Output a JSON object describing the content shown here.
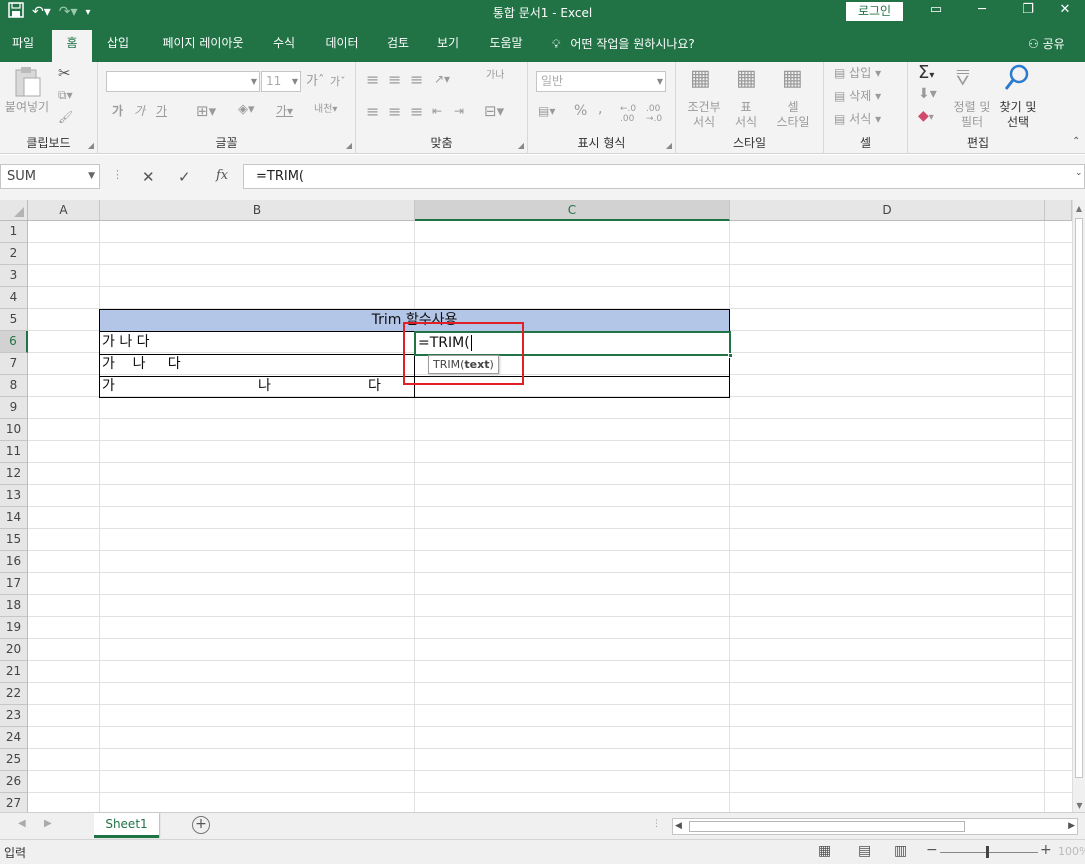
{
  "window": {
    "title": "통합 문서1  -  Excel",
    "login_label": "로그인"
  },
  "tabs": [
    "파일",
    "홈",
    "삽입",
    "페이지 레이아웃",
    "수식",
    "데이터",
    "검토",
    "보기",
    "도움말"
  ],
  "active_tab": "홈",
  "tell_me": "어떤 작업을 원하시나요?",
  "share_label": "공유",
  "ribbon": {
    "groups": {
      "clipboard": "클립보드",
      "font": "글꼴",
      "alignment": "맞춤",
      "number": "표시 형식",
      "styles": "스타일",
      "cells": "셀",
      "editing": "편집"
    },
    "paste_label": "붙여넣기",
    "font_size": "11",
    "font_bold": "가",
    "font_italic": "가",
    "font_underline": "가",
    "font_grow": "가",
    "font_shrink": "가",
    "font_color_glyph": "가",
    "phonetic_glyph": "내천",
    "vertical_text_glyph": "가나",
    "number_format": "일반",
    "percent": "%",
    "comma": ",",
    "conditional_format": "조건부\n서식",
    "format_as_table": "표\n서식",
    "cell_styles": "셀\n스타일",
    "insert": "삽입",
    "delete": "삭제",
    "format": "서식",
    "sort_filter": "정렬 및\n필터",
    "find_select": "찾기 및\n선택"
  },
  "formula_bar": {
    "name_box": "SUM",
    "cancel": "✕",
    "enter": "✓",
    "fx": "fx",
    "content": "=TRIM("
  },
  "grid": {
    "columns": [
      "A",
      "B",
      "C",
      "D"
    ],
    "selected_column": "C",
    "rows": [
      "1",
      "2",
      "3",
      "4",
      "5",
      "6",
      "7",
      "8",
      "9",
      "10",
      "11",
      "12",
      "13",
      "14",
      "15",
      "16",
      "17",
      "18",
      "19",
      "20",
      "21",
      "22",
      "23",
      "24",
      "25",
      "26",
      "27"
    ],
    "selected_row": "6",
    "header_cell": "Trim 함수사용",
    "b6": "가 나 다",
    "b7": "가    나     다",
    "b8": "가",
    "b8_mid": "나",
    "b8_end": "다",
    "c6": "=TRIM(",
    "tooltip_fn": "TRIM(",
    "tooltip_arg": "text",
    "tooltip_close": ")"
  },
  "sheet_tab": "Sheet1",
  "status": {
    "mode": "입력",
    "zoom": "100%"
  },
  "colors": {
    "excel_green": "#217346",
    "header_fill": "#b4c6e7",
    "annotation_red": "#e11f26"
  }
}
